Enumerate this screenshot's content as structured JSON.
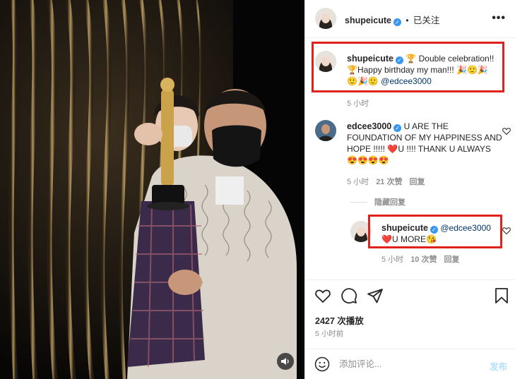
{
  "header": {
    "username": "shupeicute",
    "separator": "•",
    "follow_state": "已关注",
    "more_label": "•••"
  },
  "caption": {
    "username": "shupeicute",
    "line1_text": " Double celebration!!",
    "line2_text": "Happy birthday my man!!! ",
    "mention": "@edcee3000",
    "time": "5 小时"
  },
  "comment": {
    "username": "edcee3000",
    "text_part1": " U ARE THE FOUNDATION OF MY HAPPINESS AND HOPE !!!!! ",
    "text_part2": "U !!!! THANK U ALWAYS ",
    "emoji_tail": "😍😍😍😍",
    "heart": "❤️",
    "time": "5 小时",
    "likes": "21 次赞",
    "reply": "回复"
  },
  "hide_replies": "隐藏回复",
  "reply": {
    "username": "shupeicute",
    "mention": "@edcee3000",
    "text": "U MORE",
    "heart": "❤️",
    "emoji": "😘",
    "time": "5 小时",
    "likes": "10 次赞",
    "reply": "回复"
  },
  "stats": {
    "views": "2427 次播放",
    "time_ago": "5 小时前"
  },
  "composer": {
    "placeholder": "添加评论...",
    "post_label": "发布"
  },
  "icons": {
    "like": "heart-icon",
    "comment": "comment-icon",
    "share": "send-icon",
    "save": "bookmark-icon",
    "emoji": "smiley-icon",
    "sound": "speaker-icon",
    "verified": "verified-badge-icon"
  },
  "colors": {
    "highlight_box": "#e0221d",
    "verified": "#3897f0",
    "mention": "#00376b",
    "muted": "#8e8e8e",
    "post_disabled": "#b2dffc"
  }
}
